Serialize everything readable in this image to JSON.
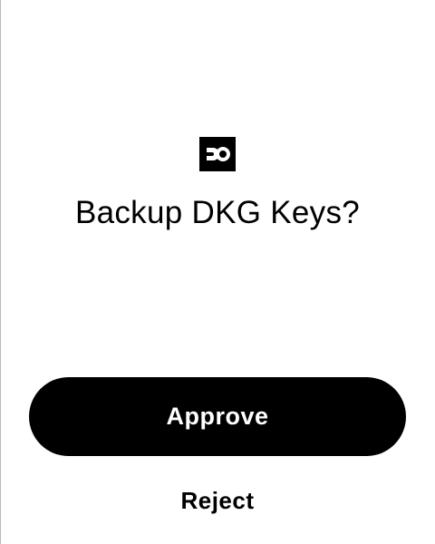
{
  "logo": {
    "icon": "ledger-logo-icon",
    "background_color": "#000000",
    "foreground_color": "#ffffff"
  },
  "dialog": {
    "title": "Backup DKG Keys?"
  },
  "actions": {
    "approve_label": "Approve",
    "reject_label": "Reject",
    "primary_color": "#000000",
    "primary_text_color": "#ffffff"
  }
}
